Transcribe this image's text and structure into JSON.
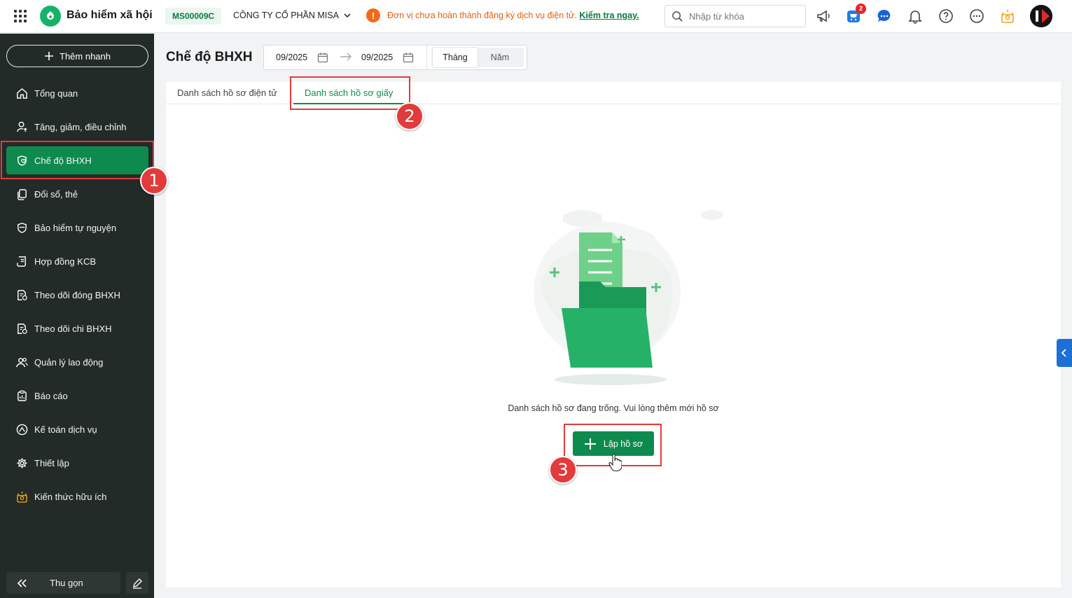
{
  "header": {
    "app_title": "Bảo hiểm xã hội",
    "tax_code": "MS00009C",
    "company": "CÔNG TY CỔ PHẦN MISA",
    "warning_text": "Đơn vị chưa hoàn thành đăng ký dịch vụ điện tử.",
    "warning_link": "Kiểm tra ngay.",
    "search_placeholder": "Nhập từ khóa",
    "cart_badge": "2"
  },
  "sidebar": {
    "quick_add": "Thêm nhanh",
    "items": [
      {
        "label": "Tổng quan",
        "icon": "home-icon"
      },
      {
        "label": "Tăng, giảm, điều chỉnh",
        "icon": "user-arrow-icon"
      },
      {
        "label": "Chế độ BHXH",
        "icon": "shield-heart-icon",
        "active": true
      },
      {
        "label": "Đổi sổ, thẻ",
        "icon": "copy-icon"
      },
      {
        "label": "Bảo hiểm tự nguyện",
        "icon": "shield-icon"
      },
      {
        "label": "Hợp đồng KCB",
        "icon": "contract-icon"
      },
      {
        "label": "Theo dõi đóng BHXH",
        "icon": "doc-track-icon"
      },
      {
        "label": "Theo dõi chi BHXH",
        "icon": "doc-track-icon"
      },
      {
        "label": "Quản lý lao động",
        "icon": "users-icon"
      },
      {
        "label": "Báo cáo",
        "icon": "report-icon"
      },
      {
        "label": "Kế toán dịch vụ",
        "icon": "service-icon"
      },
      {
        "label": "Thiết lập",
        "icon": "gear-icon"
      },
      {
        "label": "Kiến thức hữu ích",
        "icon": "knowledge-icon"
      }
    ],
    "collapse": "Thu gọn"
  },
  "main": {
    "page_title": "Chế độ BHXH",
    "date_from": "09/2025",
    "date_to": "09/2025",
    "period_options": [
      "Tháng",
      "Năm"
    ],
    "period_selected": "Tháng",
    "tabs": [
      "Danh sách hồ sơ điện tử",
      "Danh sách hồ sơ giấy"
    ],
    "active_tab": "Danh sách hồ sơ giấy",
    "empty_message": "Danh sách hồ sơ đang trống. Vui lòng thêm mới hồ sơ",
    "create_button": "Lập hồ sơ"
  },
  "annotations": {
    "step1": "1",
    "step2": "2",
    "step3": "3"
  },
  "colors": {
    "primary": "#0f8a4e",
    "sidebar_bg": "#232b28",
    "warning": "#f16a1b",
    "highlight": "#e23b3b"
  }
}
